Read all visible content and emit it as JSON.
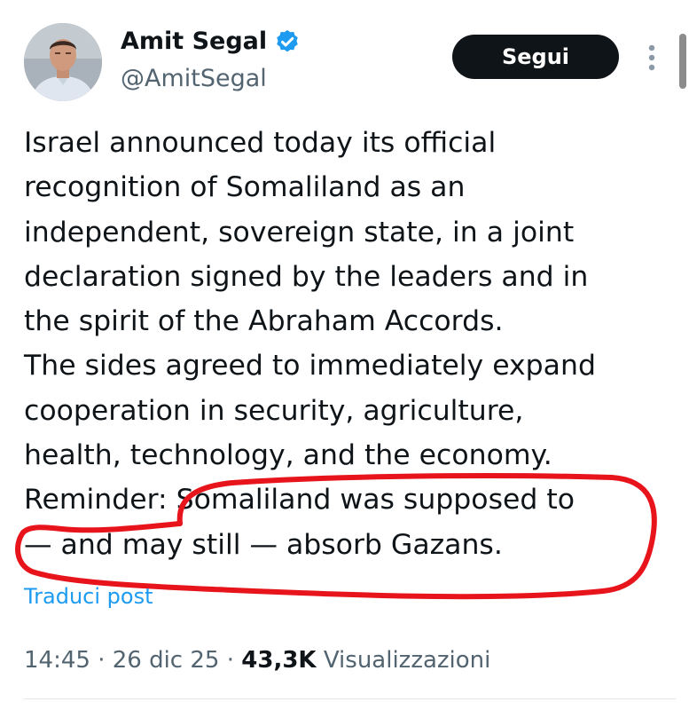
{
  "author": {
    "display_name": "Amit Segal",
    "handle": "@AmitSegal",
    "verified": true
  },
  "follow_button": {
    "label": "Segui"
  },
  "tweet": {
    "lines": [
      "Israel announced today its official",
      "recognition of Somaliland as an",
      "independent, sovereign state, in a joint",
      "declaration signed by the leaders and in",
      "the spirit of the Abraham Accords.",
      "The sides agreed to immediately expand",
      "cooperation in security, agriculture,",
      "health, technology, and the economy.",
      "Reminder: Somaliland was supposed to",
      "— and may still — absorb Gazans."
    ]
  },
  "translate_link": "Traduci post",
  "meta": {
    "time": "14:45",
    "separator": "·",
    "date": "26 dic 25",
    "views_count": "43,3K",
    "views_label": "Visualizzazioni"
  },
  "colors": {
    "text_primary": "#0f1419",
    "text_secondary": "#536471",
    "link": "#1d9bf0",
    "verified_badge": "#1d9bf0",
    "button_background": "#0f1419",
    "highlight_marker": "#e8141c"
  },
  "icons": {
    "verified": "verified-badge-icon",
    "more": "more-vertical-icon"
  }
}
